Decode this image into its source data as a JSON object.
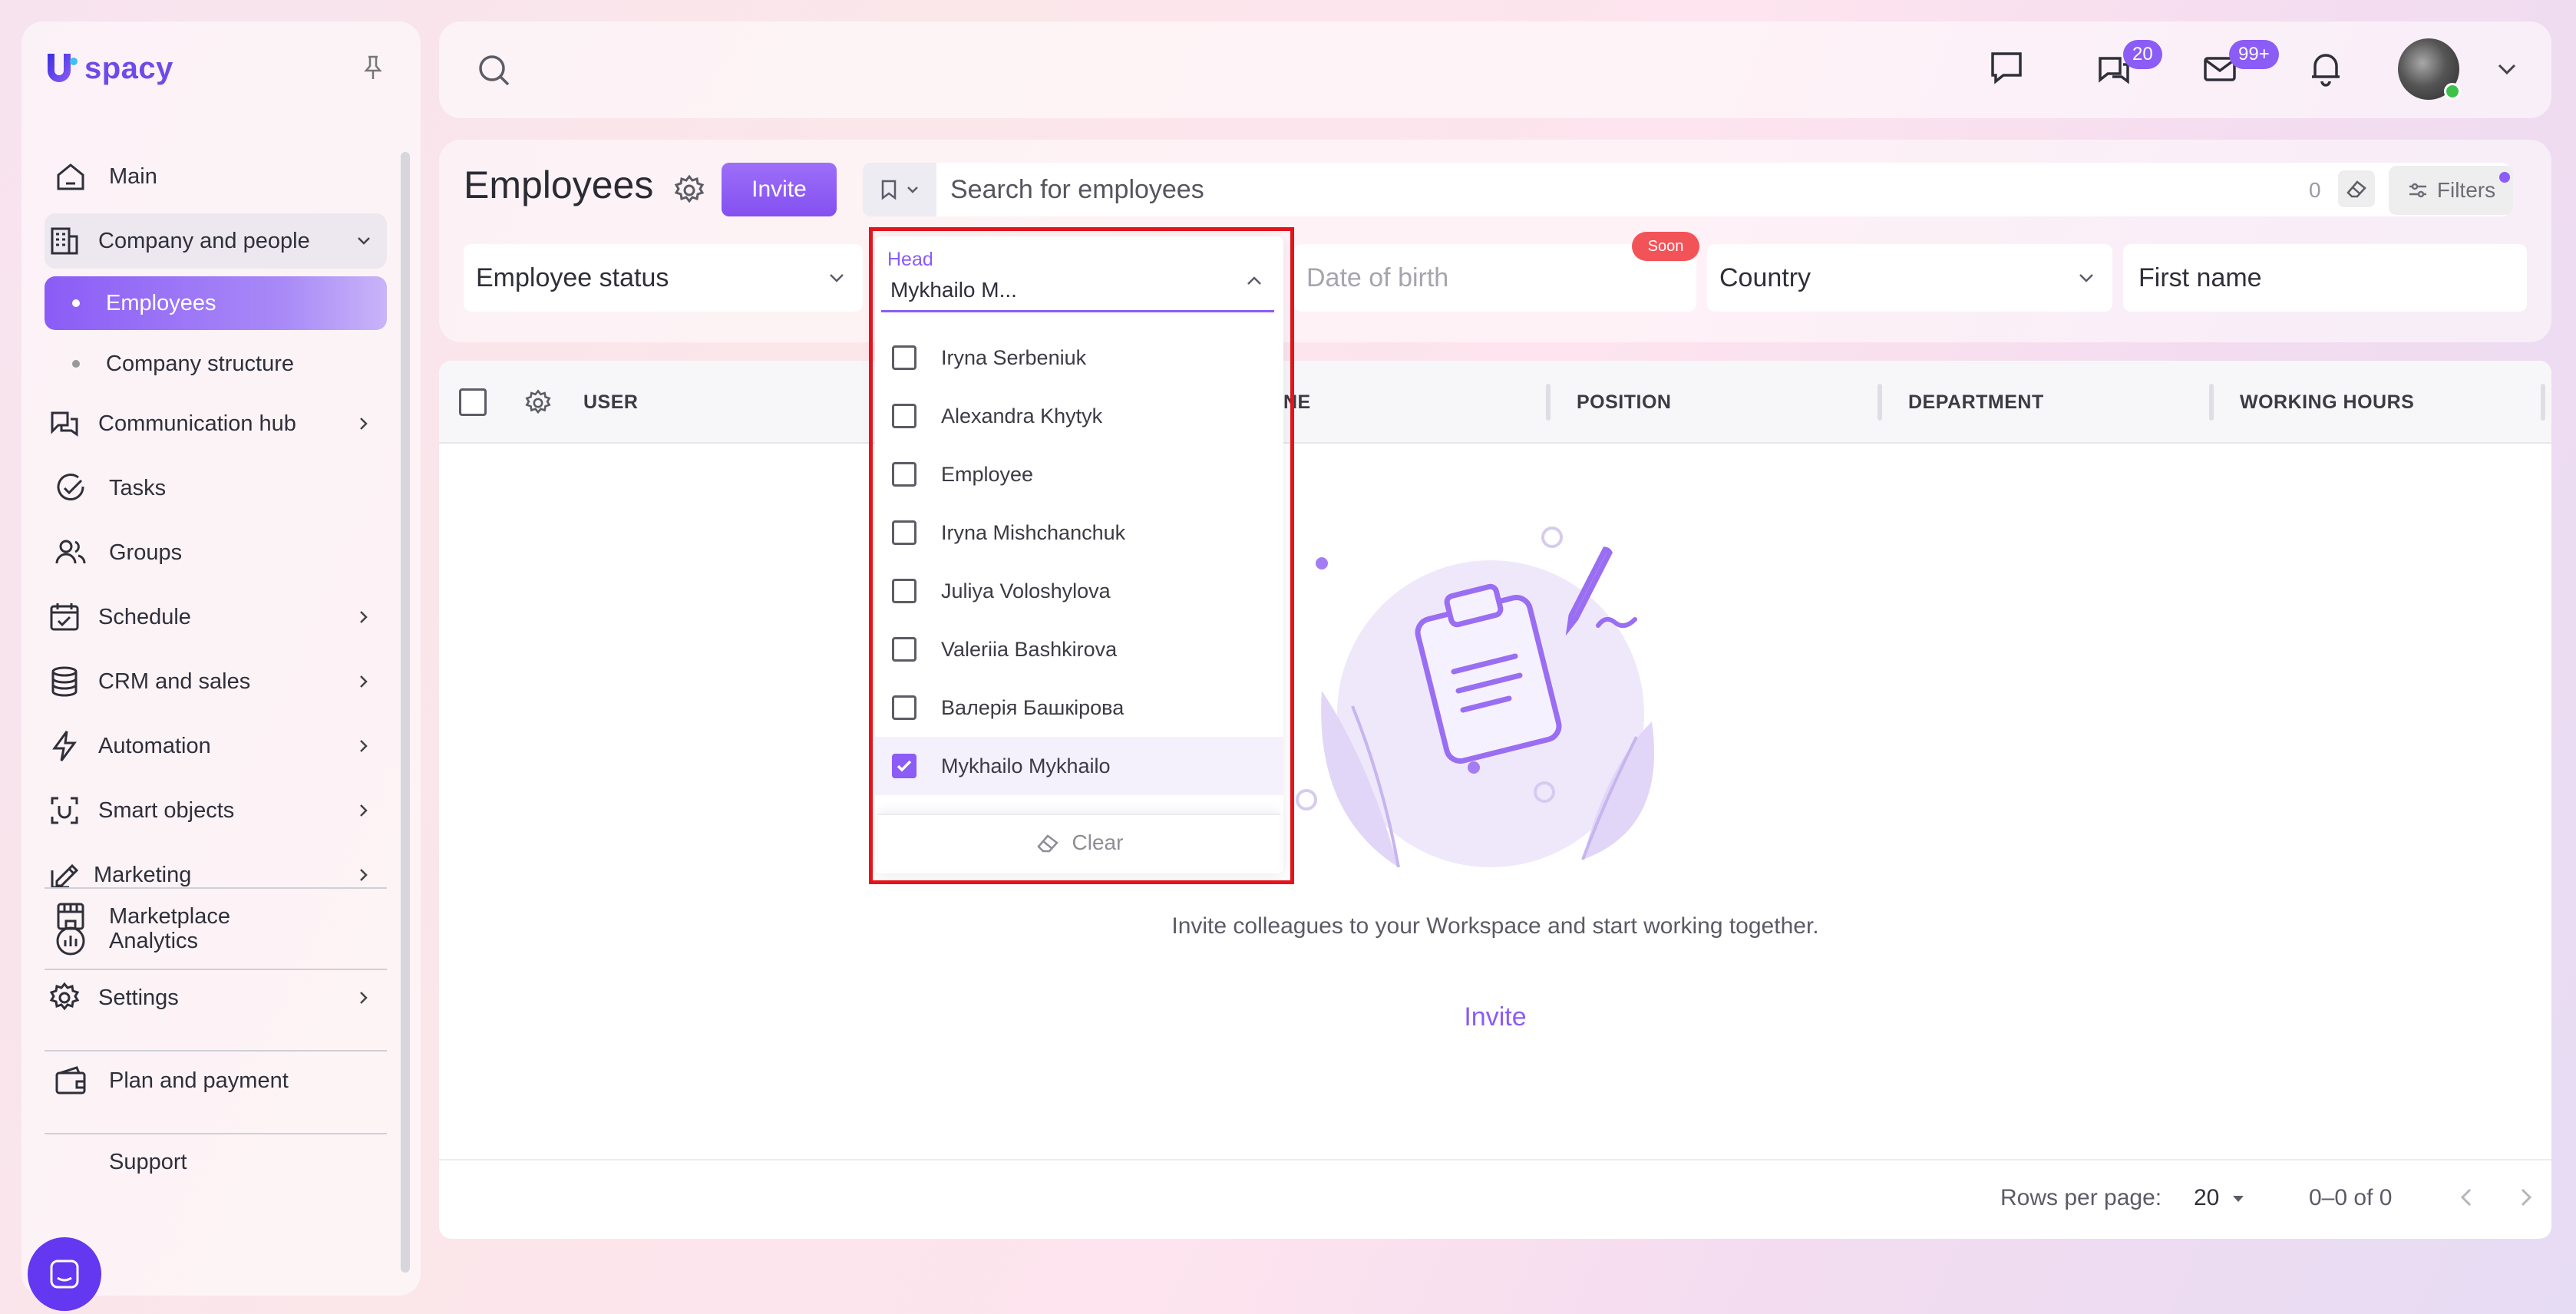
{
  "brand": {
    "logo_text": "spacy"
  },
  "sidebar": {
    "items": [
      {
        "label": "Main",
        "icon": "home-icon"
      },
      {
        "label": "Company and people",
        "icon": "building-icon"
      },
      {
        "label": "Employees"
      },
      {
        "label": "Company structure"
      },
      {
        "label": "Communication hub",
        "icon": "chat-icon"
      },
      {
        "label": "Tasks",
        "icon": "check-circle-icon"
      },
      {
        "label": "Groups",
        "icon": "users-icon"
      },
      {
        "label": "Schedule",
        "icon": "calendar-icon"
      },
      {
        "label": "CRM and sales",
        "icon": "database-icon"
      },
      {
        "label": "Automation",
        "icon": "bolt-icon"
      },
      {
        "label": "Smart objects",
        "icon": "scan-icon"
      },
      {
        "label": "Marketing",
        "icon": "megaphone-icon"
      },
      {
        "label": "Analytics",
        "icon": "chart-icon"
      },
      {
        "label": "Marketplace",
        "icon": "store-icon"
      },
      {
        "label": "Settings",
        "icon": "gear-icon"
      },
      {
        "label": "Plan and payment",
        "icon": "wallet-icon"
      },
      {
        "label": "Support",
        "icon": "support-icon"
      }
    ]
  },
  "topbar": {
    "chat_badge": "20",
    "mail_badge": "99+"
  },
  "header": {
    "title": "Employees",
    "invite_label": "Invite",
    "search_placeholder": "Search for employees",
    "search_count": "0",
    "filters_label": "Filters"
  },
  "filters": {
    "employee_status": "Employee status",
    "head_label": "Head",
    "head_value": "Mykhailo M...",
    "date_of_birth": "Date of birth",
    "soon_badge": "Soon",
    "country": "Country",
    "first_name": "First name"
  },
  "dropdown": {
    "options": [
      {
        "label": "Iryna Serbeniuk",
        "checked": false
      },
      {
        "label": "Alexandra Khytyk",
        "checked": false
      },
      {
        "label": "Employee",
        "checked": false
      },
      {
        "label": "Iryna Mishchanchuk",
        "checked": false
      },
      {
        "label": "Juliya Voloshylova",
        "checked": false
      },
      {
        "label": "Valeriia Bashkirova",
        "checked": false
      },
      {
        "label": "Валерія Башкірова",
        "checked": false
      },
      {
        "label": "Mykhailo Mykhailo",
        "checked": true
      }
    ],
    "clear_label": "Clear"
  },
  "table": {
    "columns": [
      "USER",
      "NE",
      "POSITION",
      "DEPARTMENT",
      "WORKING HOURS"
    ]
  },
  "empty_state": {
    "message": "Invite colleagues to your Workspace and start working together.",
    "invite_label": "Invite"
  },
  "pagination": {
    "rows_per_page_label": "Rows per page:",
    "rows_per_page": "20",
    "range": "0–0 of 0"
  },
  "colors": {
    "accent": "#8b5cf6",
    "badge_soon": "#f25358",
    "highlight": "#e4131c"
  }
}
